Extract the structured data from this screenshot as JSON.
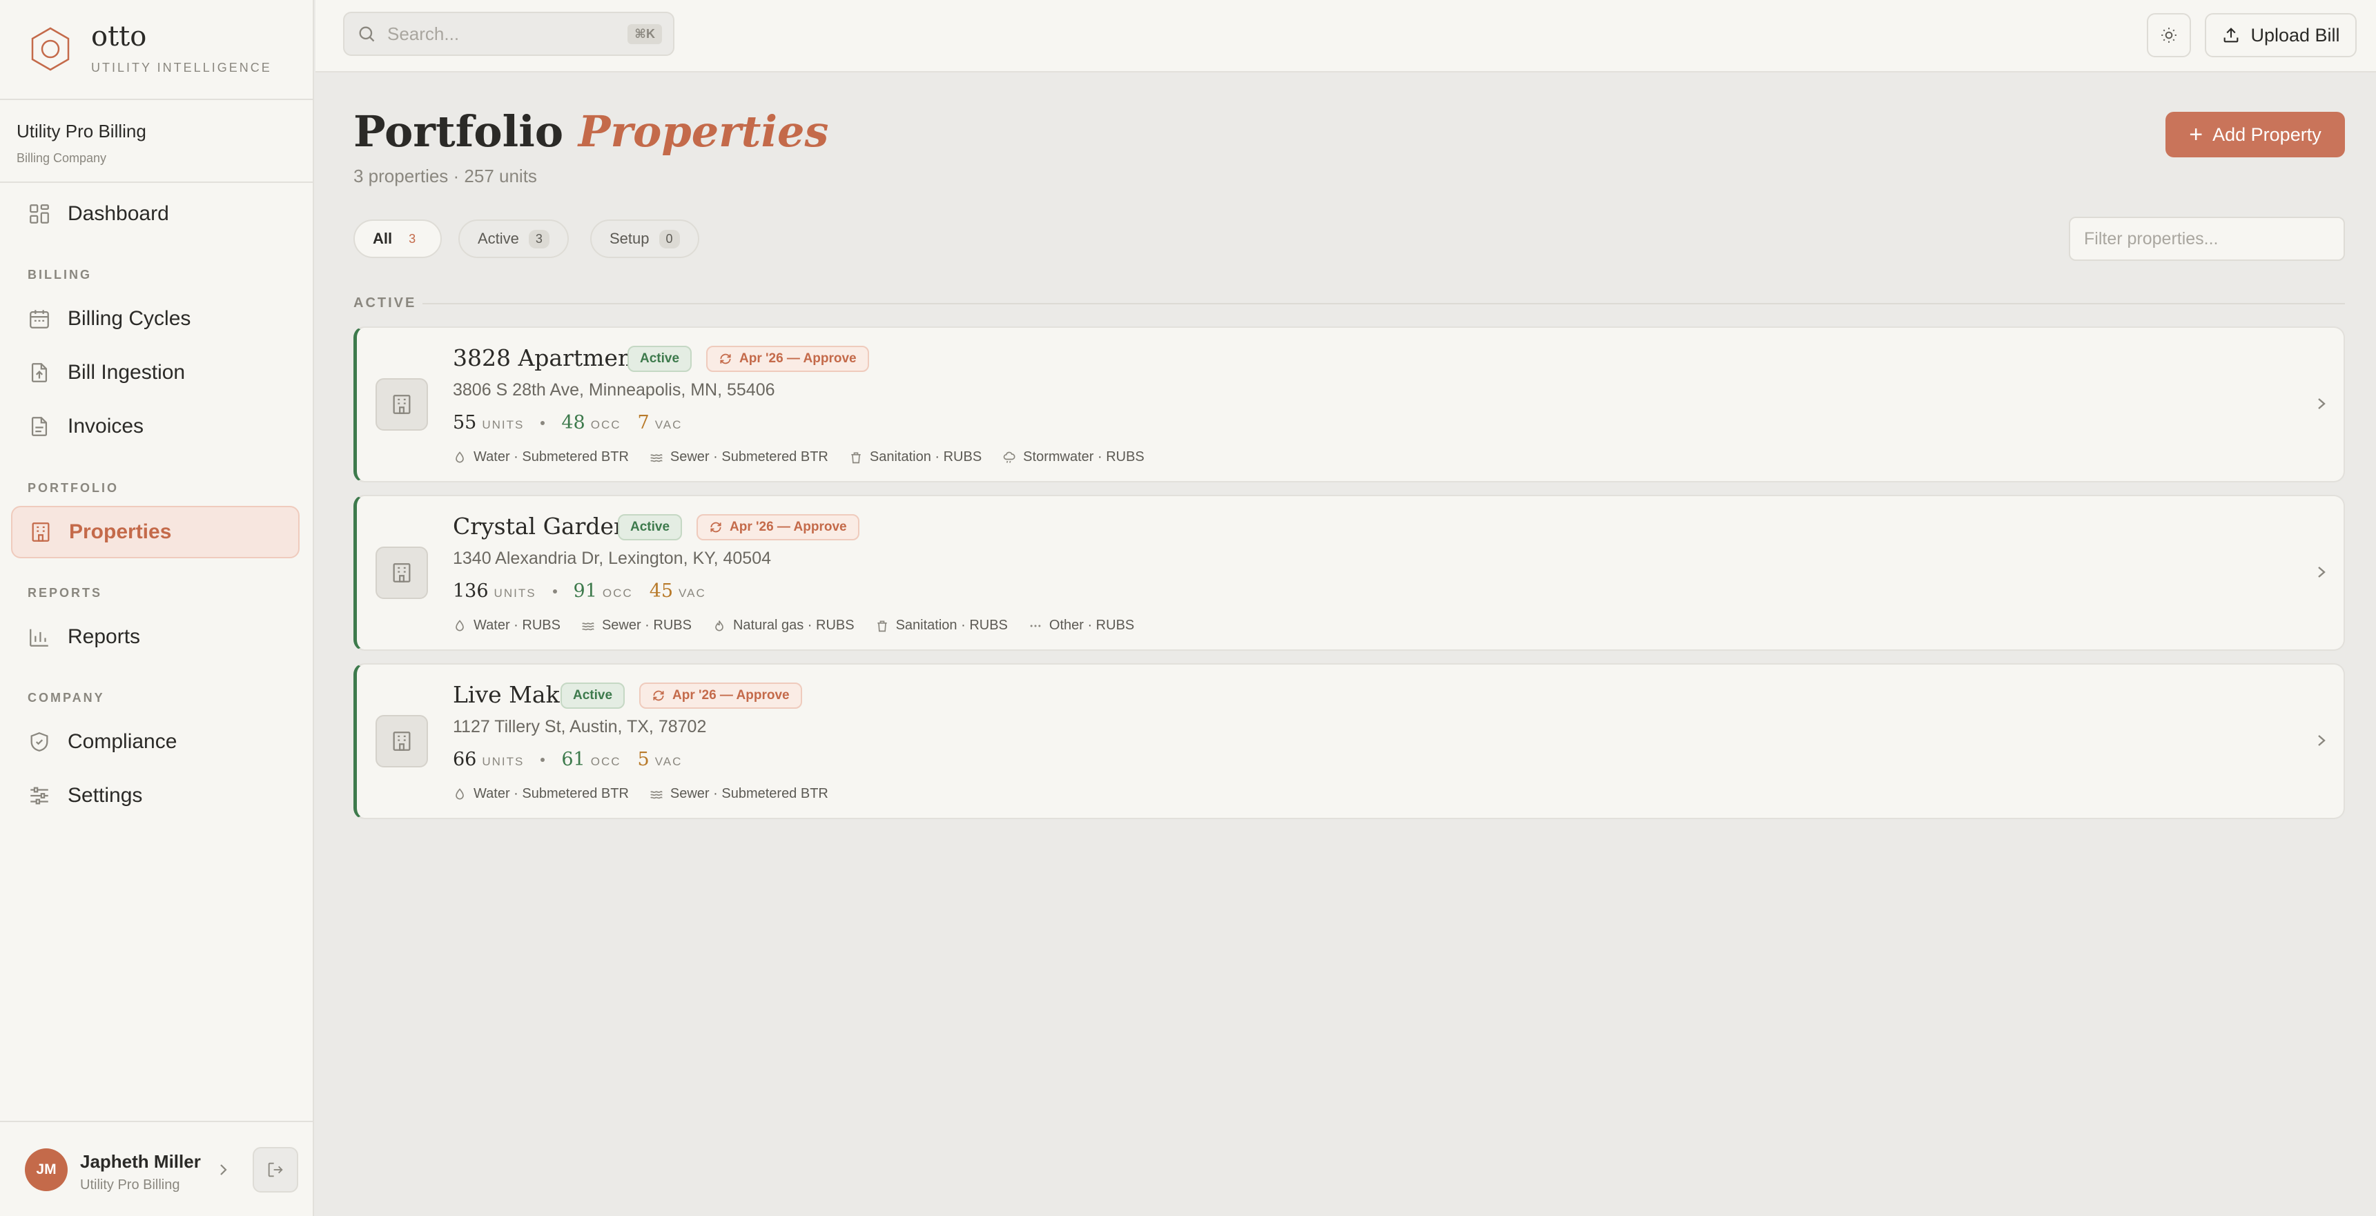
{
  "brand": {
    "name": "otto",
    "tagline": "UTILITY INTELLIGENCE"
  },
  "org": {
    "name": "Utility Pro Billing",
    "type": "Billing Company"
  },
  "nav": {
    "dashboard": "Dashboard",
    "billing_label": "BILLING",
    "billing_cycles": "Billing Cycles",
    "bill_ingestion": "Bill Ingestion",
    "invoices": "Invoices",
    "portfolio_label": "PORTFOLIO",
    "properties": "Properties",
    "reports_label": "REPORTS",
    "reports": "Reports",
    "company_label": "COMPANY",
    "compliance": "Compliance",
    "settings": "Settings"
  },
  "user": {
    "initials": "JM",
    "name": "Japheth Miller",
    "org": "Utility Pro Billing"
  },
  "topbar": {
    "search_placeholder": "Search...",
    "search_shortcut": "⌘K",
    "upload_label": "Upload Bill"
  },
  "page": {
    "title_main": "Portfolio",
    "title_accent": "Properties",
    "subtitle": "3 properties · 257 units",
    "add_label": "Add Property",
    "filter_placeholder": "Filter properties...",
    "group_label": "ACTIVE"
  },
  "tabs": [
    {
      "label": "All",
      "count": "3"
    },
    {
      "label": "Active",
      "count": "3"
    },
    {
      "label": "Setup",
      "count": "0"
    }
  ],
  "properties": [
    {
      "name": "3828 Apartments",
      "status": "Active",
      "cycle": "Apr '26 — Approve",
      "address": "3806 S 28th Ave, Minneapolis, MN, 55406",
      "units": "55",
      "units_label": "UNITS",
      "occ": "48",
      "occ_label": "OCC",
      "vac": "7",
      "vac_label": "VAC",
      "utilities": [
        "Water · Submetered BTR",
        "Sewer · Submetered BTR",
        "Sanitation · RUBS",
        "Stormwater · RUBS"
      ]
    },
    {
      "name": "Crystal Gardens",
      "status": "Active",
      "cycle": "Apr '26 — Approve",
      "address": "1340 Alexandria Dr, Lexington, KY, 40504",
      "units": "136",
      "units_label": "UNITS",
      "occ": "91",
      "occ_label": "OCC",
      "vac": "45",
      "vac_label": "VAC",
      "utilities": [
        "Water · RUBS",
        "Sewer · RUBS",
        "Natural gas · RUBS",
        "Sanitation · RUBS",
        "Other · RUBS"
      ]
    },
    {
      "name": "Live Make",
      "status": "Active",
      "cycle": "Apr '26 — Approve",
      "address": "1127 Tillery St, Austin, TX, 78702",
      "units": "66",
      "units_label": "UNITS",
      "occ": "61",
      "occ_label": "OCC",
      "vac": "5",
      "vac_label": "VAC",
      "utilities": [
        "Water · Submetered BTR",
        "Sewer · Submetered BTR"
      ]
    }
  ],
  "colors": {
    "accent": "#c46a4a",
    "active_green": "#3d7a4c",
    "vacant": "#b87a2a"
  }
}
